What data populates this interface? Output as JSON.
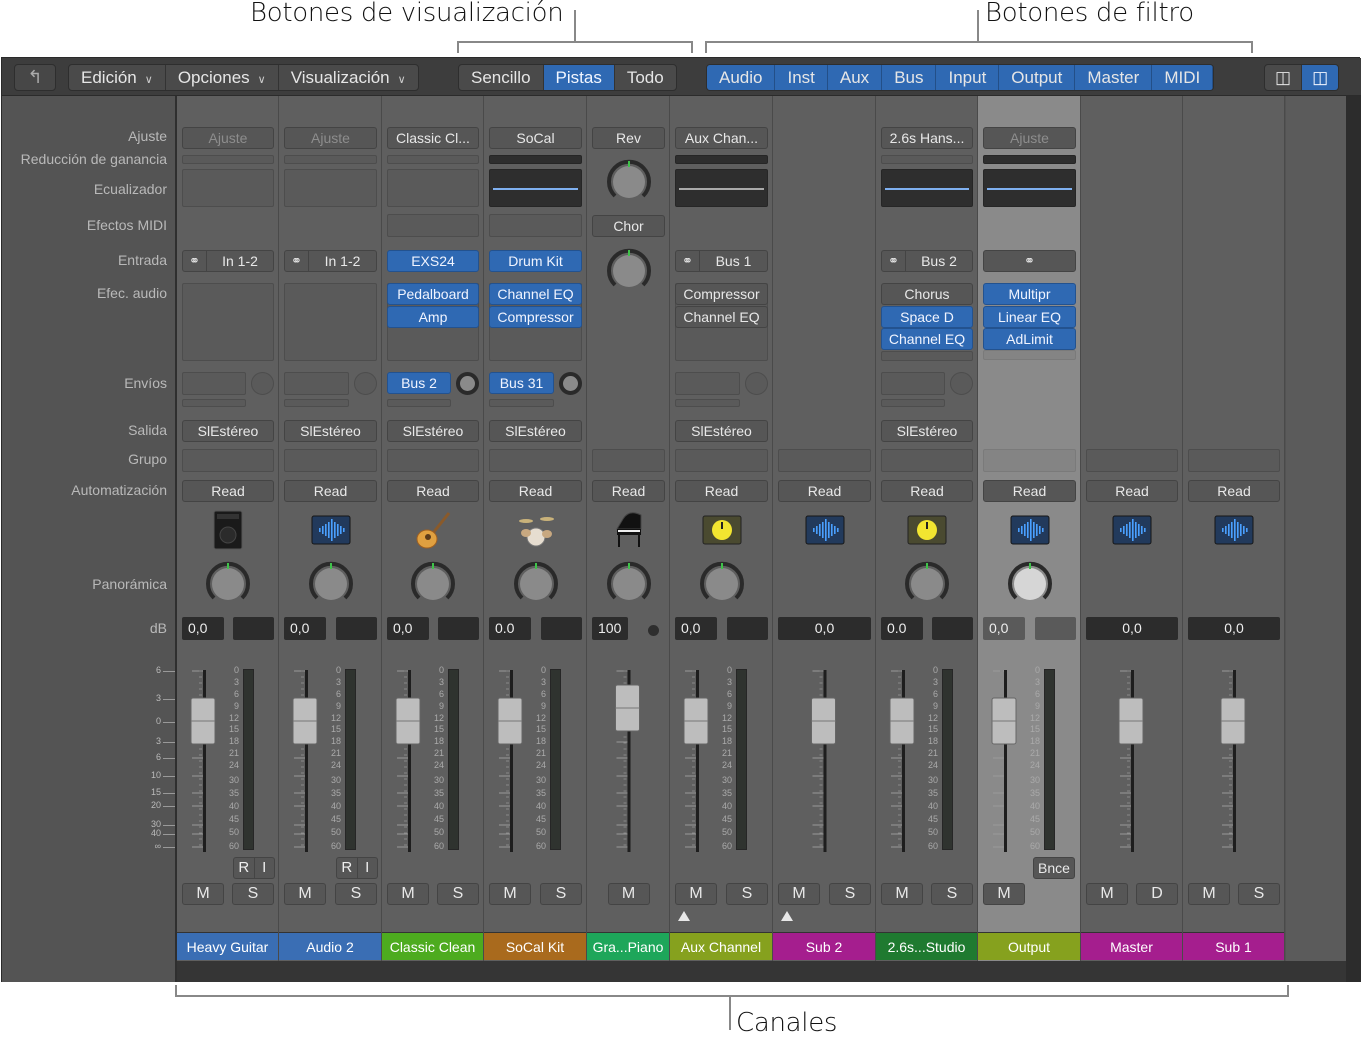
{
  "annotations": {
    "view_buttons": "Botones de visualización",
    "filter_buttons": "Botones de filtro",
    "channels": "Canales"
  },
  "toolbar": {
    "back_icon": "back-arrow-icon",
    "menus": [
      "Edición",
      "Opciones",
      "Visualización"
    ],
    "view_buttons": [
      {
        "label": "Sencillo",
        "active": false
      },
      {
        "label": "Pistas",
        "active": true
      },
      {
        "label": "Todo",
        "active": false
      }
    ],
    "filter_buttons": [
      "Audio",
      "Inst",
      "Aux",
      "Bus",
      "Input",
      "Output",
      "Master",
      "MIDI"
    ],
    "layout_icons": [
      "narrow-strips-icon",
      "wide-strips-icon"
    ]
  },
  "row_labels": {
    "setting": "Ajuste",
    "gain_reduction": "Reducción de ganancia",
    "eq": "Ecualizador",
    "midi_fx": "Efectos MIDI",
    "input": "Entrada",
    "audio_fx": "Efec. audio",
    "sends": "Envíos",
    "output": "Salida",
    "group": "Grupo",
    "automation": "Automatización",
    "pan": "Panorámica",
    "db": "dB"
  },
  "fader_scale": [
    "6",
    "3",
    "0",
    "3",
    "6",
    "10",
    "15",
    "20",
    "30",
    "40",
    "∞"
  ],
  "meter_scale": [
    "0",
    "3",
    "6",
    "9",
    "12",
    "15",
    "18",
    "21",
    "24",
    "30",
    "35",
    "40",
    "45",
    "50",
    "60"
  ],
  "colors": {
    "accent": "#2f69b3",
    "selected_strip": "#8a8a8a"
  },
  "channels": [
    {
      "name": "Heavy Guitar",
      "color": "#3a6eb4",
      "setting": "Ajuste",
      "setting_dim": true,
      "gr": "light",
      "eq": "empty",
      "midi": false,
      "input": {
        "label": "In 1-2",
        "link": true,
        "blue": false
      },
      "fx": [],
      "fx_box": true,
      "send": {
        "label": "",
        "blue": false
      },
      "output": "SlEstéreo",
      "automation": "Read",
      "icon": "amp-icon",
      "pan": 0,
      "db": "0,0",
      "peak": "box",
      "meter": true,
      "ri": [
        "R",
        "I"
      ],
      "buttons": [
        "M",
        "S"
      ]
    },
    {
      "name": "Audio 2",
      "color": "#3a6eb4",
      "setting": "Ajuste",
      "setting_dim": true,
      "gr": "light",
      "eq": "empty",
      "midi": false,
      "input": {
        "label": "In 1-2",
        "link": true,
        "blue": false
      },
      "fx": [],
      "fx_box": true,
      "send": {
        "label": "",
        "blue": false
      },
      "output": "SlEstéreo",
      "automation": "Read",
      "icon": "waveform-icon",
      "pan": 0,
      "db": "0,0",
      "peak": "box",
      "meter": true,
      "ri": [
        "R",
        "I"
      ],
      "buttons": [
        "M",
        "S"
      ]
    },
    {
      "name": "Classic Clean",
      "color": "#4dab1f",
      "setting": "Classic Cl...",
      "gr": "light",
      "eq": "empty",
      "midi": true,
      "input": {
        "label": "EXS24",
        "link": false,
        "blue": true
      },
      "fx": [
        {
          "label": "Pedalboard",
          "blue": true
        },
        {
          "label": "Amp",
          "blue": true
        }
      ],
      "fx_box": true,
      "send": {
        "label": "Bus 2",
        "blue": true
      },
      "output": "SlEstéreo",
      "automation": "Read",
      "icon": "guitar-icon",
      "pan": 0,
      "db": "0,0",
      "peak": "box",
      "meter": true,
      "buttons": [
        "M",
        "S"
      ]
    },
    {
      "name": "SoCal Kit",
      "color": "#a96a1d",
      "setting": "SoCal",
      "gr": "dark",
      "eq": "blue",
      "midi": true,
      "input": {
        "label": "Drum Kit",
        "link": false,
        "blue": true
      },
      "fx": [
        {
          "label": "Channel EQ",
          "blue": true
        },
        {
          "label": "Compressor",
          "blue": true
        }
      ],
      "fx_box": true,
      "send": {
        "label": "Bus 31",
        "blue": true
      },
      "output": "SlEstéreo",
      "automation": "Read",
      "icon": "drum-kit-icon",
      "pan": 0,
      "db": "0.0",
      "peak": "box",
      "meter": true,
      "buttons": [
        "M",
        "S"
      ]
    },
    {
      "name": "Gra...Piano",
      "color": "#1ea65a",
      "piano": true,
      "sends_knobs": [
        "Rev",
        "Chor"
      ],
      "automation": "Read",
      "icon": "grand-piano-icon",
      "pan": 0,
      "db": "100",
      "peak": "dot",
      "meter": false,
      "buttons": [
        "M"
      ]
    },
    {
      "name": "Aux Channel",
      "color": "#86a11e",
      "setting": "Aux Chan...",
      "gr": "dark",
      "eq": "dark",
      "midi": false,
      "input": {
        "label": "Bus 1",
        "link": true,
        "blue": false
      },
      "fx": [
        {
          "label": "Compressor",
          "blue": false
        },
        {
          "label": "Channel EQ",
          "blue": false
        }
      ],
      "fx_box": true,
      "send": {
        "label": "",
        "blue": false
      },
      "output": "SlEstéreo",
      "automation": "Read",
      "icon": "yellow-knob-icon",
      "pan": 0,
      "db": "0,0",
      "peak": "box",
      "meter": true,
      "buttons": [
        "M",
        "S"
      ],
      "triangle": true
    },
    {
      "name": "Sub 2",
      "color": "#a51e8e",
      "automation": "Read",
      "icon": "waveform-icon",
      "db": "0,0",
      "peak": "wide",
      "meter": false,
      "buttons": [
        "M",
        "S"
      ],
      "triangle": true
    },
    {
      "name": "2.6s...Studio",
      "color": "#1f7a30",
      "setting": "2.6s Hans...",
      "gr": "light",
      "eq": "blue",
      "midi": false,
      "input": {
        "label": "Bus 2",
        "link": true,
        "blue": false
      },
      "fx": [
        {
          "label": "Chorus",
          "blue": false
        },
        {
          "label": "Space D",
          "blue": true
        },
        {
          "label": "Channel EQ",
          "blue": true
        }
      ],
      "fx_box": false,
      "send": {
        "label": "",
        "blue": false
      },
      "output": "SlEstéreo",
      "automation": "Read",
      "icon": "yellow-knob-icon",
      "pan": 0,
      "db": "0.0",
      "peak": "box",
      "meter": true,
      "buttons": [
        "M",
        "S"
      ]
    },
    {
      "name": "Output",
      "color": "#86a11e",
      "selected": true,
      "setting": "Ajuste",
      "setting_dim": true,
      "gr": "dark",
      "eq": "blue",
      "midi": false,
      "input": {
        "label": "",
        "link": true,
        "blue": false
      },
      "fx": [
        {
          "label": "Multipr",
          "blue": true
        },
        {
          "label": "Linear EQ",
          "blue": true
        },
        {
          "label": "AdLimit",
          "blue": true
        }
      ],
      "fx_box": false,
      "automation": "Read",
      "icon": "waveform-icon",
      "pan": 0,
      "pan_light": true,
      "db": "0,0",
      "peak": "box",
      "meter": true,
      "bnce": "Bnce",
      "buttons": [
        "M"
      ]
    },
    {
      "name": "Master",
      "color": "#a51e8e",
      "automation": "Read",
      "icon": "waveform-icon",
      "db": "0,0",
      "peak": "wide",
      "meter": false,
      "buttons": [
        "M",
        "D"
      ]
    },
    {
      "name": "Sub 1",
      "color": "#a51e8e",
      "automation": "Read",
      "icon": "waveform-icon",
      "db": "0,0",
      "peak": "wide",
      "meter": false,
      "buttons": [
        "M",
        "S"
      ]
    }
  ]
}
